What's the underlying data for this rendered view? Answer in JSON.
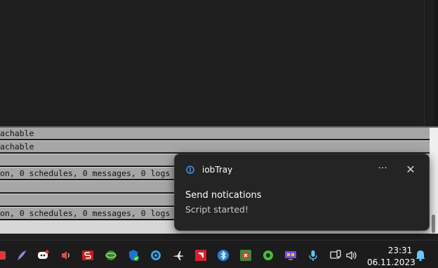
{
  "log_rows": [
    "achable",
    "achable",
    "",
    "on, 0 schedules, 0 messages, 0 logs",
    "",
    "",
    "on, 0 schedules, 0 messages, 0 logs"
  ],
  "notification": {
    "app_name": "iobTray",
    "title": "Send notications",
    "body": "Script started!",
    "more_glyph": "···",
    "close_glyph": "✕"
  },
  "taskbar": {
    "icons": [
      "red-app-icon",
      "purple-feather-icon",
      "discord-icon",
      "audio-app-icon",
      "red-s-icon",
      "green-globe-icon",
      "shield-check-icon",
      "disc-icon",
      "airplane-icon",
      "amd-icon",
      "bluetooth-icon",
      "red-app-icon-2",
      "green-splash-icon",
      "monitor-icon",
      "microphone-icon",
      "display-icon",
      "volume-icon",
      "bell-icon"
    ]
  },
  "clock": {
    "time": "23:31",
    "date": "06.11.2023"
  }
}
